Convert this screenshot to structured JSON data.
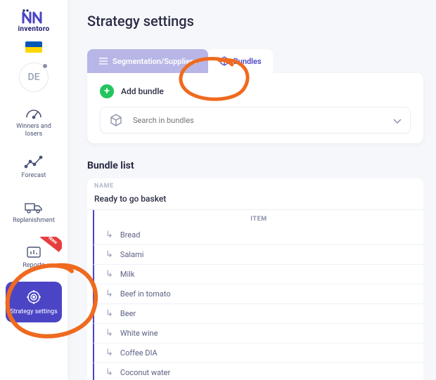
{
  "brand": {
    "name": "inventoro"
  },
  "user": {
    "initials": "DE"
  },
  "sidebar": {
    "items": [
      {
        "label": "Winners and losers"
      },
      {
        "label": "Forecast"
      },
      {
        "label": "Replenishment"
      },
      {
        "label": "Reports",
        "badge": "New"
      },
      {
        "label": "Strategy settings"
      }
    ]
  },
  "page": {
    "title": "Strategy settings"
  },
  "tabs": {
    "segmentation": "Segmentation/Suppliers",
    "bundles": "Bundles"
  },
  "panel": {
    "add_bundle": "Add bundle",
    "search_placeholder": "Search in bundles"
  },
  "bundle_list": {
    "title": "Bundle list",
    "name_col": "NAME",
    "item_col": "ITEM",
    "bundle_name": "Ready to go basket",
    "items": [
      "Bread",
      "Salami",
      "Milk",
      "Beef in tomato",
      "Beer",
      "White wine",
      "Coffee DIA",
      "Coconut water"
    ]
  }
}
